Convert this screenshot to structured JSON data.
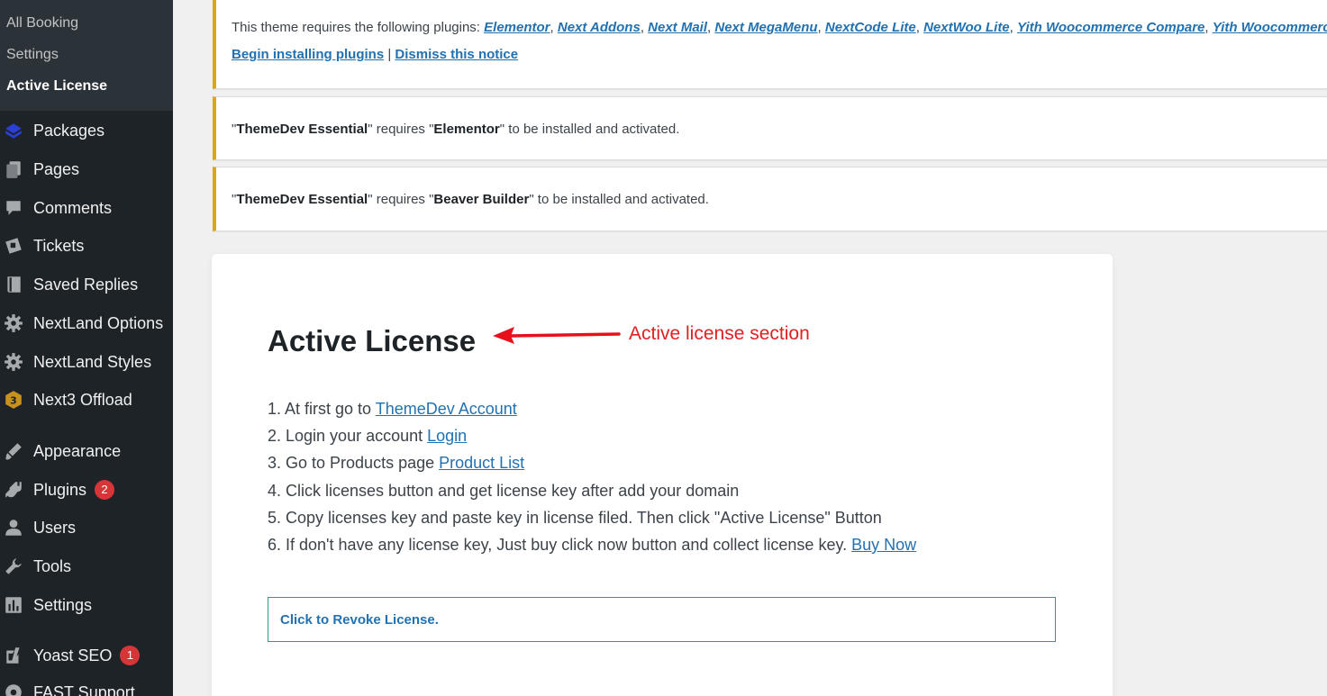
{
  "sidebar": {
    "submenu": [
      {
        "label": "All Booking"
      },
      {
        "label": "Settings"
      },
      {
        "label": "Active License"
      }
    ],
    "menu": [
      {
        "label": "Packages",
        "icon": "packages-icon"
      },
      {
        "label": "Pages",
        "icon": "pages-icon"
      },
      {
        "label": "Comments",
        "icon": "comments-icon"
      },
      {
        "label": "Tickets",
        "icon": "tickets-icon"
      },
      {
        "label": "Saved Replies",
        "icon": "book-icon"
      },
      {
        "label": "NextLand Options",
        "icon": "gear-icon"
      },
      {
        "label": "NextLand Styles",
        "icon": "gear-icon"
      },
      {
        "label": "Next3 Offload",
        "icon": "next3-icon"
      },
      {
        "label": "Appearance",
        "icon": "brush-icon"
      },
      {
        "label": "Plugins",
        "icon": "plugin-icon",
        "badge": "2"
      },
      {
        "label": "Users",
        "icon": "user-icon"
      },
      {
        "label": "Tools",
        "icon": "wrench-icon"
      },
      {
        "label": "Settings",
        "icon": "settings-icon"
      },
      {
        "label": "Yoast SEO",
        "icon": "yoast-icon",
        "badge": "1"
      },
      {
        "label": "FAST Support",
        "icon": "support-icon"
      }
    ]
  },
  "notices": {
    "plugins": {
      "prefix": "This theme requires the following plugins: ",
      "plugins": [
        "Elementor",
        "Next Addons",
        "Next Mail",
        "Next MegaMenu",
        "NextCode Lite",
        "NextWoo Lite",
        "Yith Woocommerce Compare",
        "Yith Woocommerce Wishlist"
      ],
      "begin_link": "Begin installing plugins",
      "separator": " | ",
      "dismiss_link": "Dismiss this notice"
    },
    "elementor": {
      "q1": "\"",
      "name": "ThemeDev Essential",
      "mid": "\" requires \"",
      "req": "Elementor",
      "end": "\" to be installed and activated."
    },
    "beaver": {
      "q1": "\"",
      "name": "ThemeDev Essential",
      "mid": "\" requires \"",
      "req": "Beaver Builder",
      "end": "\" to be installed and activated."
    }
  },
  "card": {
    "title": "Active License",
    "steps": [
      {
        "text": "1. At first go to ",
        "link": "ThemeDev Account"
      },
      {
        "text": "2. Login your account ",
        "link": "Login"
      },
      {
        "text": "3. Go to Products page ",
        "link": "Product List"
      },
      {
        "text": "4. Click licenses button and get license key after add your domain",
        "link": ""
      },
      {
        "text": "5. Copy licenses key and paste key in license filed. Then click \"Active License\" Button",
        "link": ""
      },
      {
        "text": "6. If don't have any license key, Just buy click now button and collect license key. ",
        "link": "Buy Now"
      }
    ],
    "revoke": "Click to Revoke License."
  },
  "annotation": {
    "text": "Active license section",
    "color": "#e02020"
  },
  "colors": {
    "sidebar": "#1d2327",
    "submenu": "#2c3338",
    "link": "#2271b1",
    "notice_warning": "#dba617",
    "badge": "#d63638"
  }
}
